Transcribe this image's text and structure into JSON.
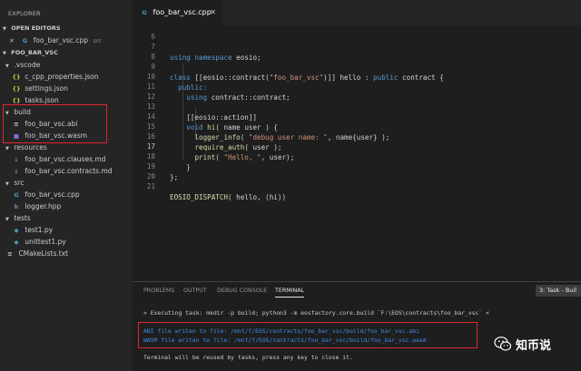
{
  "explorer": {
    "title": "EXPLORER",
    "open_editors_header": "OPEN EDITORS",
    "open_editor": {
      "name": "foo_bar_vsc.cpp",
      "folder": "src"
    },
    "project_header": "FOO_BAR_VSC",
    "tree": [
      {
        "name": ".vscode",
        "type": "folder"
      },
      {
        "name": "c_cpp_properties.json",
        "type": "json"
      },
      {
        "name": "settings.json",
        "type": "json"
      },
      {
        "name": "tasks.json",
        "type": "json"
      },
      {
        "name": "build",
        "type": "folder"
      },
      {
        "name": "foo_bar_vsc.abi",
        "type": "file"
      },
      {
        "name": "foo_bar_vsc.wasm",
        "type": "wasm"
      },
      {
        "name": "resources",
        "type": "folder"
      },
      {
        "name": "foo_bar_vsc.clauses.md",
        "type": "md"
      },
      {
        "name": "foo_bar_vsc.contracts.md",
        "type": "md"
      },
      {
        "name": "src",
        "type": "folder"
      },
      {
        "name": "foo_bar_vsc.cpp",
        "type": "cpp"
      },
      {
        "name": "logger.hpp",
        "type": "cpp"
      },
      {
        "name": "tests",
        "type": "folder"
      },
      {
        "name": "test1.py",
        "type": "py"
      },
      {
        "name": "unittest1.py",
        "type": "py"
      },
      {
        "name": "CMakeLists.txt",
        "type": "txt"
      }
    ]
  },
  "editor": {
    "tab_label": "foo_bar_vsc.cpp",
    "lines": [
      {
        "n": "6",
        "t": ""
      },
      {
        "n": "7",
        "t": "using namespace eosio;"
      },
      {
        "n": "8",
        "t": ""
      },
      {
        "n": "9",
        "t": "class [[eosio::contract(\"foo_bar_vsc\")]] hello : public contract {"
      },
      {
        "n": "10",
        "t": "  public:"
      },
      {
        "n": "11",
        "t": "    using contract::contract;"
      },
      {
        "n": "12",
        "t": ""
      },
      {
        "n": "13",
        "t": "    [[eosio::action]]"
      },
      {
        "n": "14",
        "t": "    void hi( name user ) {"
      },
      {
        "n": "15",
        "t": "      logger_info( \"debug user name: \", name{user} );"
      },
      {
        "n": "16",
        "t": "      require_auth( user );"
      },
      {
        "n": "17",
        "t": "      print( \"Hello, \", user);"
      },
      {
        "n": "18",
        "t": "    }"
      },
      {
        "n": "19",
        "t": "};"
      },
      {
        "n": "20",
        "t": ""
      },
      {
        "n": "21",
        "t": "EOSIO_DISPATCH( hello, (hi))"
      }
    ]
  },
  "panel": {
    "tabs": [
      "PROBLEMS",
      "OUTPUT",
      "DEBUG CONSOLE",
      "TERMINAL"
    ],
    "task_select": "3: Task - Buil",
    "terminal": {
      "cmd": "> Executing task: mkdir -p build; python3 -m eosfactory.core.build `F:\\EOS\\contracts\\foo_bar_vsc` <",
      "abi": "ABI file writen to file: /mnt/f/EOS/contracts/foo_bar_vsc/build/foo_bar_vsc.abi",
      "wasm": "WASM file writen to file: /mnt/f/EOS/contracts/foo_bar_vsc/build/foo_bar_vsc.wasm",
      "reuse": "Terminal will be reused by tasks, press any key to close it."
    }
  },
  "watermark": {
    "text": "知币说"
  }
}
